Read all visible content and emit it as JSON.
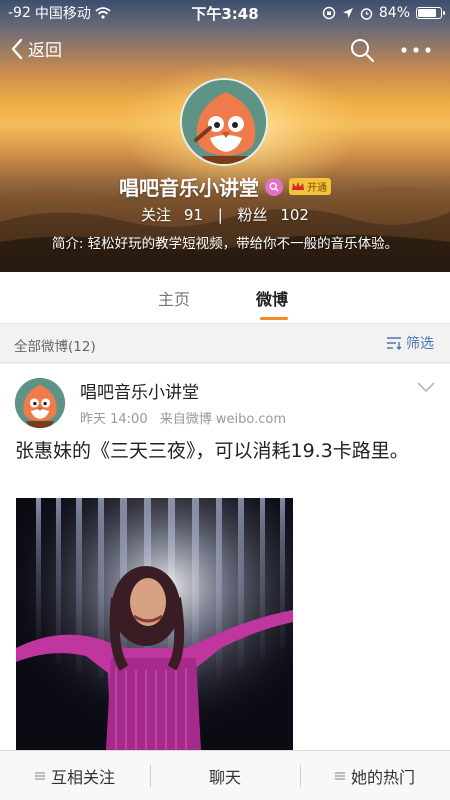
{
  "status_bar": {
    "signal": "-92",
    "carrier": "中国移动",
    "time": "下午3:48",
    "battery": "84%",
    "battery_level": 0.84
  },
  "nav": {
    "back_label": "返回"
  },
  "profile": {
    "name": "唱吧音乐小讲堂",
    "vip_label": "开通",
    "following_label": "关注",
    "following_count": "91",
    "separator": "|",
    "followers_label": "粉丝",
    "followers_count": "102",
    "bio": "简介: 轻松好玩的教学短视频，带给你不一般的音乐体验。"
  },
  "tabs": [
    {
      "label": "主页",
      "active": false
    },
    {
      "label": "微博",
      "active": true
    }
  ],
  "filter_bar": {
    "count_label": "全部微博(12)",
    "filter_label": "筛选"
  },
  "post": {
    "author": "唱吧音乐小讲堂",
    "time": "昨天 14:00",
    "source": "来自微博 weibo.com",
    "text": "张惠妹的《三天三夜》，可以消耗19.3卡路里。"
  },
  "bottom_bar": [
    {
      "label": "互相关注",
      "icon": "menu-icon"
    },
    {
      "label": "聊天",
      "icon": ""
    },
    {
      "label": "她的热门",
      "icon": "menu-icon"
    }
  ],
  "colors": {
    "accent_orange": "#f48b23",
    "link_blue": "#4a78b5",
    "verify_pink": "#e46fc4",
    "vip_gold": "#f3c43a"
  }
}
